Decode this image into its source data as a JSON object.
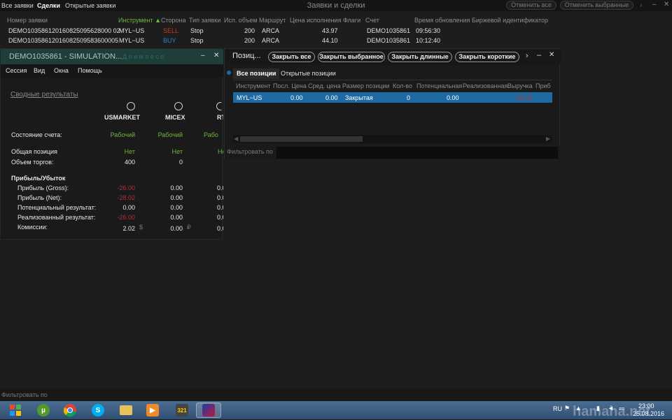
{
  "nav": {
    "all_orders": "Все заявки",
    "deals": "Сделки",
    "open_orders": "Открытые заявки"
  },
  "window_title": "Заявки и сделки",
  "top_buttons": {
    "cancel_all": "Отменить все",
    "cancel_selected": "Отменить выбранные"
  },
  "orders": {
    "columns": [
      "Номер заявки",
      "Инструмент ▲",
      "Сторона",
      "Тип заявки",
      "Исп. объем",
      "Маршрут",
      "Цена исполнения",
      "Флаги",
      "Счет",
      "Время обновления",
      "Биржевой идентификатор"
    ],
    "rows": [
      {
        "id": "DEMO103586120160825095628000 02",
        "instrument": "MYL~US",
        "side": "SELL",
        "type": "Stop",
        "qty": "200",
        "route": "ARCA",
        "price": "43.97",
        "account": "DEMO1035861",
        "time": "09:56:30"
      },
      {
        "id": "DEMO10358612016082509583600005",
        "instrument": "MYL~US",
        "side": "BUY",
        "type": "Stop",
        "qty": "200",
        "route": "ARCA",
        "price": "44.10",
        "account": "DEMO1035861",
        "time": "10:12:40"
      }
    ]
  },
  "account_window": {
    "title": "DEMO1035861 - SIMULATION...",
    "title_extra": "Д о и м о е с о",
    "menu": [
      "Сессия",
      "Вид",
      "Окна",
      "Помощь"
    ],
    "summary_title": "Сводные результаты",
    "markets": [
      "USMARKET",
      "MICEX",
      "RT"
    ],
    "rows": {
      "account_state": {
        "label": "Состояние счета:",
        "values": [
          "Рабочий",
          "Рабочий",
          "Рабо"
        ]
      },
      "total_position": {
        "label": "Общая позиция",
        "values": [
          "Нет",
          "Нет",
          "Не"
        ]
      },
      "trade_volume": {
        "label": "Объем торгов:",
        "values": [
          "400",
          "0",
          ""
        ]
      }
    },
    "pnl_title": "Прибыль/Убыток",
    "pnl": [
      {
        "label": "Прибыль (Gross):",
        "values": [
          "-26.00",
          "0.00",
          "0.0"
        ]
      },
      {
        "label": "Прибыль (Net):",
        "values": [
          "-28.02",
          "0.00",
          "0.0"
        ]
      },
      {
        "label": "Потенциальный результат:",
        "values": [
          "0.00",
          "0.00",
          "0.0"
        ]
      },
      {
        "label": "Реализованный результат:",
        "values": [
          "-26.00",
          "0.00",
          "0.0"
        ]
      },
      {
        "label": "Комиссии:",
        "values": [
          "2.02",
          "0.00",
          "0.0"
        ]
      }
    ],
    "currencies": [
      "$",
      "₽"
    ]
  },
  "positions_window": {
    "title": "Позиц...",
    "buttons": {
      "close_all": "Закрыть все",
      "close_selected": "Закрыть выбранное",
      "close_long": "Закрыть длинные",
      "close_short": "Закрыть короткие"
    },
    "tabs": {
      "all": "Все позиции",
      "open": "Открытые позиции"
    },
    "columns": [
      "Инструмент",
      "Посл. Цена",
      "Сред. цена",
      "Размер позиции",
      "Кол-во",
      "Потенциальная",
      "Реализованная",
      "Выручка",
      "Приб"
    ],
    "row": {
      "instrument": "MYL~US",
      "last": "0.00",
      "avg": "0.00",
      "size": "Закрытая",
      "qty": "0",
      "potential": "0.00",
      "realized": "",
      "revenue": "-26.00"
    },
    "filter_label": "Фильтровать по"
  },
  "bottom_filter_label": "Фильтровать по",
  "taskbar": {
    "apps": [
      "windows-start",
      "utorrent",
      "chrome",
      "skype",
      "explorer",
      "media-player",
      "movie-editor",
      "trading-app"
    ],
    "lang": "RU",
    "time": "23:00",
    "date": "25.08.2016",
    "watermark": "hamaha.net"
  },
  "colors": {
    "accent_green": "#6fb63e",
    "loss_red": "#b23232",
    "selection_blue": "#1e6aa3",
    "sell_red": "#c0392b",
    "buy_blue": "#2f7fc4"
  }
}
